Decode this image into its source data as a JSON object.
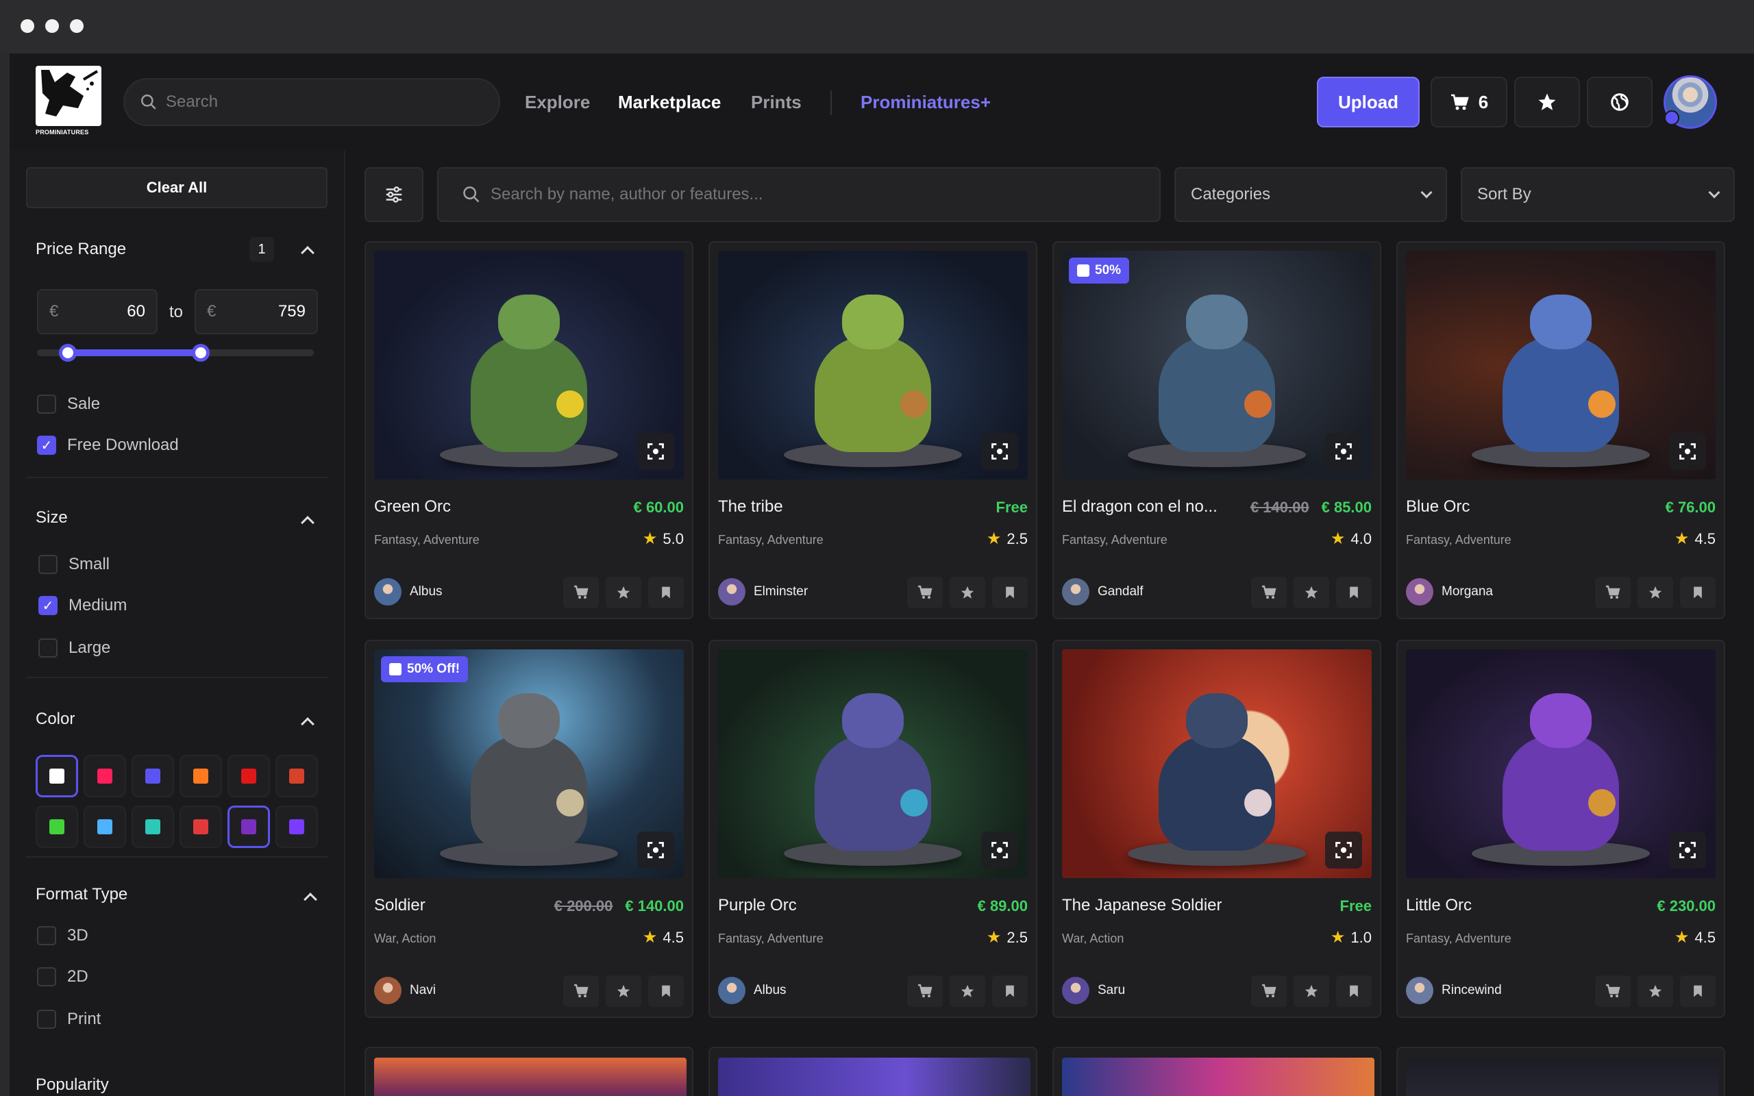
{
  "header": {
    "logo_text": "PROMINIATURES",
    "search_placeholder": "Search",
    "nav": [
      {
        "label": "Explore"
      },
      {
        "label": "Marketplace"
      },
      {
        "label": "Prints"
      }
    ],
    "plus_label": "Prominiatures+",
    "upload_label": "Upload",
    "cart_count": "6"
  },
  "sidebar": {
    "clear_all": "Clear All",
    "price": {
      "title": "Price Range",
      "badge": "1",
      "currency": "€",
      "min": "60",
      "max": "759",
      "to": "to"
    },
    "options": {
      "sale": "Sale",
      "free_download": "Free Download"
    },
    "size": {
      "title": "Size",
      "items": [
        "Small",
        "Medium",
        "Large"
      ]
    },
    "color": {
      "title": "Color",
      "swatches": [
        "#ffffff",
        "#ff1f5a",
        "#5b54f0",
        "#ff7a1f",
        "#e01818",
        "#d6422a",
        "#44d23a",
        "#4db2ff",
        "#2cc9b6",
        "#e23a3a",
        "#7b2fbf",
        "#7a3cff"
      ]
    },
    "format": {
      "title": "Format Type",
      "items": [
        "3D",
        "2D",
        "Print"
      ]
    },
    "popularity": {
      "title": "Popularity"
    }
  },
  "toolbar": {
    "search_placeholder": "Search by name, author or features...",
    "categories": "Categories",
    "sort": "Sort By"
  },
  "products": [
    {
      "title": "Green Orc",
      "old_price": "",
      "price": "€ 60.00",
      "tags": "Fantasy, Adventure",
      "rating": "5.0",
      "author": "Albus",
      "badge": ""
    },
    {
      "title": "The tribe",
      "old_price": "",
      "price": "Free",
      "tags": "Fantasy, Adventure",
      "rating": "2.5",
      "author": "Elminster",
      "badge": ""
    },
    {
      "title": "El dragon con el no...",
      "old_price": "€ 140.00",
      "price": "€ 85.00",
      "tags": "Fantasy, Adventure",
      "rating": "4.0",
      "author": "Gandalf",
      "badge": "50%"
    },
    {
      "title": "Blue Orc",
      "old_price": "",
      "price": "€ 76.00",
      "tags": "Fantasy, Adventure",
      "rating": "4.5",
      "author": "Morgana",
      "badge": ""
    },
    {
      "title": "Soldier",
      "old_price": "€ 200.00",
      "price": "€ 140.00",
      "tags": "War, Action",
      "rating": "4.5",
      "author": "Navi",
      "badge": "50% Off!"
    },
    {
      "title": "Purple Orc",
      "old_price": "",
      "price": "€ 89.00",
      "tags": "Fantasy, Adventure",
      "rating": "2.5",
      "author": "Albus",
      "badge": ""
    },
    {
      "title": "The Japanese Soldier",
      "old_price": "",
      "price": "Free",
      "tags": "War, Action",
      "rating": "1.0",
      "author": "Saru",
      "badge": ""
    },
    {
      "title": "Little Orc",
      "old_price": "",
      "price": "€ 230.00",
      "tags": "Fantasy, Adventure",
      "rating": "4.5",
      "author": "Rincewind",
      "badge": ""
    }
  ]
}
